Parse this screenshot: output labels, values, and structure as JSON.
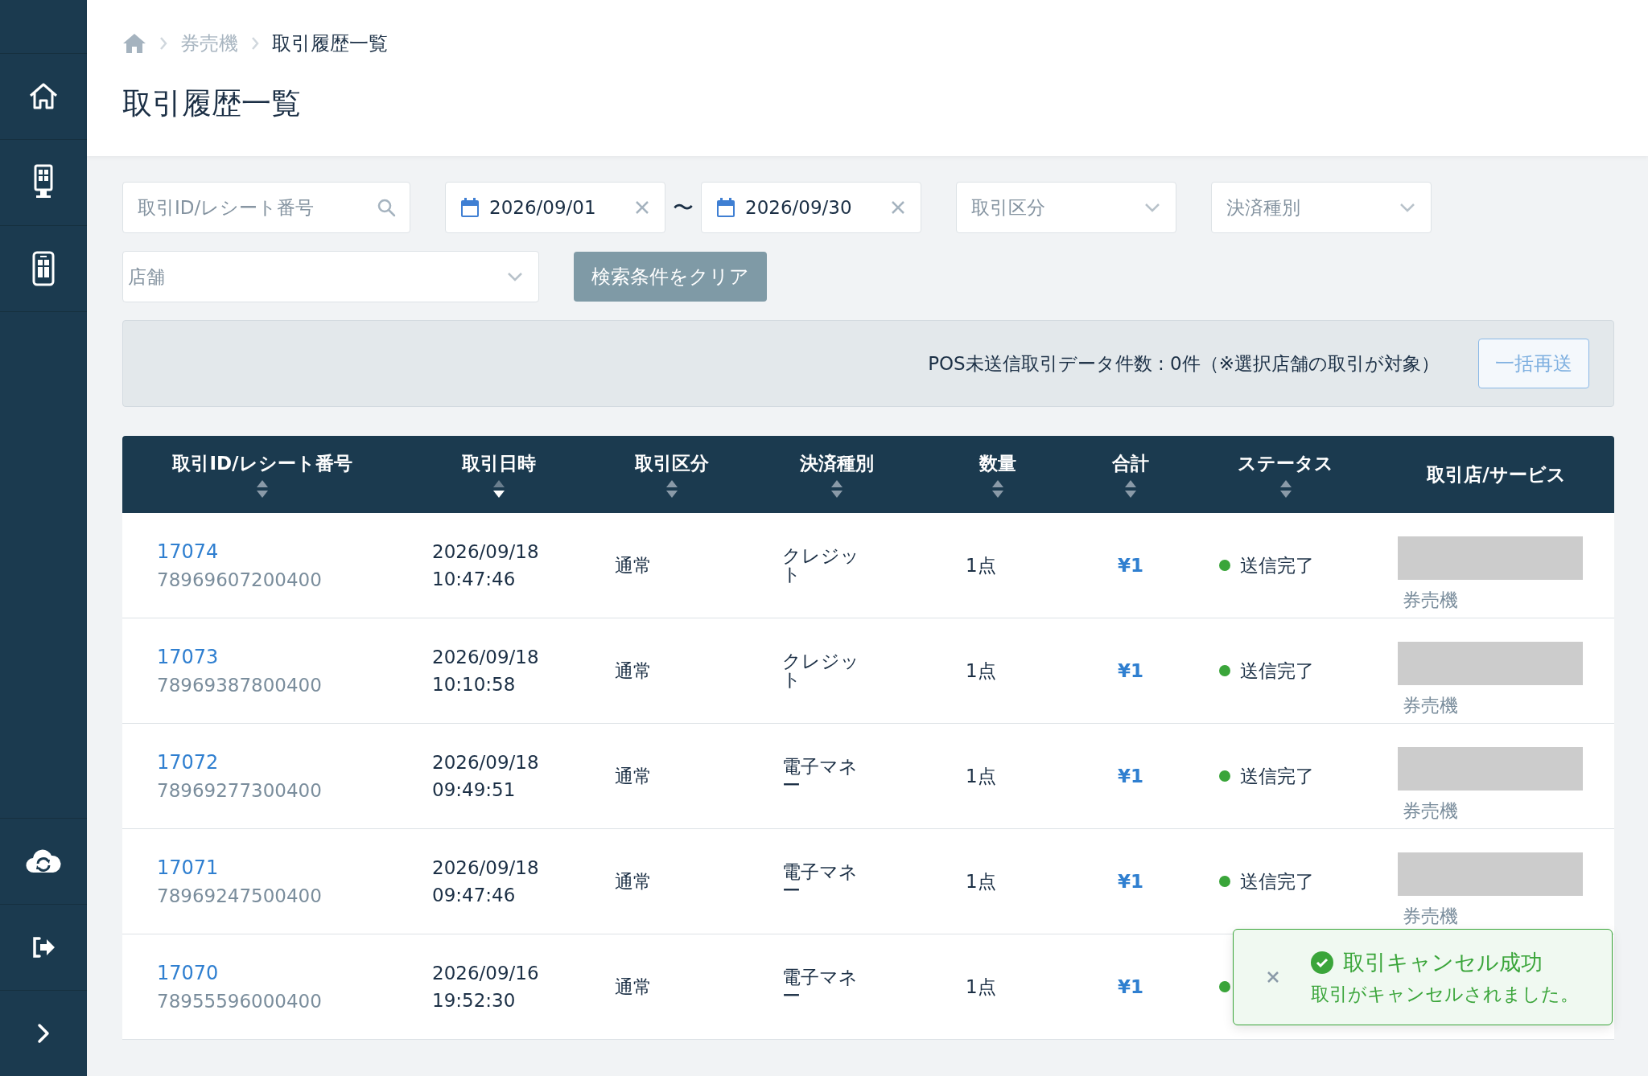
{
  "sidebar": {
    "items": [
      {
        "kind": "home",
        "selected": false
      },
      {
        "kind": "kiosk",
        "selected": false
      },
      {
        "kind": "tablet",
        "selected": false
      }
    ],
    "bottom_items": [
      {
        "kind": "sync"
      },
      {
        "kind": "logout"
      },
      {
        "kind": "expand"
      }
    ]
  },
  "breadcrumb": [
    {
      "kind": "home"
    },
    {
      "kind": "link",
      "label": "券売機"
    },
    {
      "kind": "current",
      "label": "取引履歴一覧"
    }
  ],
  "page_title": "取引履歴一覧",
  "filters": {
    "search": {
      "placeholder": "取引ID/レシート番号"
    },
    "date_from": "2026/09/01",
    "date_separator": "〜",
    "date_to": "2026/09/30",
    "type_select": {
      "placeholder": "取引区分"
    },
    "payment_select": {
      "placeholder": "決済種別"
    },
    "store_select": {
      "placeholder": "店舗"
    },
    "clear_button": "検索条件をクリア"
  },
  "pos_panel": {
    "message": "POS未送信取引データ件数 : 0件（※選択店舗の取引が対象）",
    "resend_button": "一括再送"
  },
  "table": {
    "columns": [
      {
        "label": "取引ID/レシート番号",
        "sortable": true,
        "sorted": false
      },
      {
        "label": "取引日時",
        "sortable": true,
        "sorted": true
      },
      {
        "label": "取引区分",
        "sortable": true,
        "sorted": false
      },
      {
        "label": "決済種別",
        "sortable": true,
        "sorted": false
      },
      {
        "label": "数量",
        "sortable": true,
        "sorted": false
      },
      {
        "label": "合計",
        "sortable": true,
        "sorted": false
      },
      {
        "label": "ステータス",
        "sortable": true,
        "sorted": false
      },
      {
        "label": "取引店/サービス",
        "sortable": false
      }
    ],
    "rows": [
      {
        "id": "17074",
        "receipt": "78969607200400",
        "date": "2026/09/18",
        "time": "10:47:46",
        "type": "通常",
        "payment": "クレジット",
        "qty": "1点",
        "total": "¥1",
        "status": "送信完了",
        "color": "#3aa53a",
        "store": "券売機"
      },
      {
        "id": "17073",
        "receipt": "78969387800400",
        "date": "2026/09/18",
        "time": "10:10:58",
        "type": "通常",
        "payment": "クレジット",
        "qty": "1点",
        "total": "¥1",
        "status": "送信完了",
        "color": "#3aa53a",
        "store": "券売機"
      },
      {
        "id": "17072",
        "receipt": "78969277300400",
        "date": "2026/09/18",
        "time": "09:49:51",
        "type": "通常",
        "payment": "電子マネー",
        "qty": "1点",
        "total": "¥1",
        "status": "送信完了",
        "color": "#3aa53a",
        "store": "券売機"
      },
      {
        "id": "17071",
        "receipt": "78969247500400",
        "date": "2026/09/18",
        "time": "09:47:46",
        "type": "通常",
        "payment": "電子マネー",
        "qty": "1点",
        "total": "¥1",
        "status": "送信完了",
        "color": "#3aa53a",
        "store": "券売機"
      },
      {
        "id": "17070",
        "receipt": "78955596000400",
        "date": "2026/09/16",
        "time": "19:52:30",
        "type": "通常",
        "payment": "電子マネー",
        "qty": "1点",
        "total": "¥1",
        "color": "#3aa53a"
      }
    ]
  },
  "toast": {
    "kind": "success",
    "title": "取引キャンセル成功",
    "message": "取引がキャンセルされました。"
  }
}
